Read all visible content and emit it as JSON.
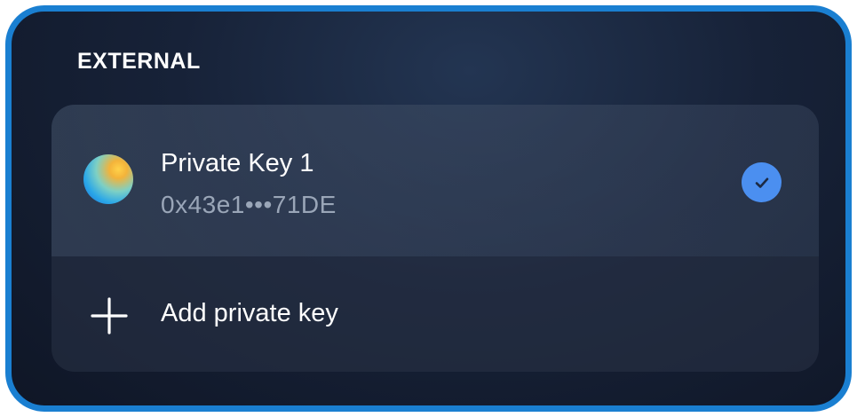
{
  "section": {
    "title": "EXTERNAL"
  },
  "account": {
    "name": "Private Key 1",
    "address": "0x43e1•••71DE",
    "selected": true
  },
  "actions": {
    "add_label": "Add private key"
  },
  "icons": {
    "avatar": "gradient-orb-avatar-icon",
    "selected": "check-circle-icon",
    "add": "plus-icon"
  },
  "colors": {
    "frame_border": "#1a7fd1",
    "background": "#172238",
    "check_fill": "#4b8ff0",
    "text_primary": "#ffffff",
    "text_secondary": "#9aa6b8"
  }
}
